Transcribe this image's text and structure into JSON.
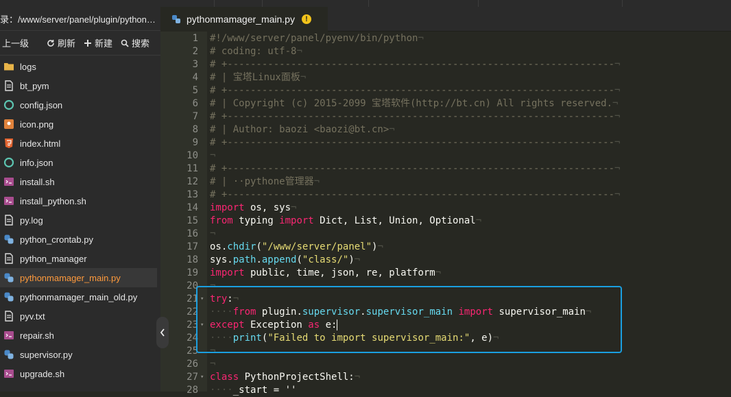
{
  "sidebar": {
    "path": "录：/www/server/panel/plugin/pythonm...",
    "toolbar": {
      "up": "上一级",
      "refresh": "刷新",
      "new": "新建",
      "search": "搜索"
    },
    "files": [
      {
        "name": "logs",
        "type": "folder-icon"
      },
      {
        "name": "bt_pym",
        "type": "file-icon"
      },
      {
        "name": "config.json",
        "type": "json-icon"
      },
      {
        "name": "icon.png",
        "type": "image-icon"
      },
      {
        "name": "index.html",
        "type": "html-icon"
      },
      {
        "name": "info.json",
        "type": "json-icon"
      },
      {
        "name": "install.sh",
        "type": "shell-icon"
      },
      {
        "name": "install_python.sh",
        "type": "shell-icon"
      },
      {
        "name": "py.log",
        "type": "file-icon"
      },
      {
        "name": "python_crontab.py",
        "type": "python-icon"
      },
      {
        "name": "python_manager",
        "type": "file-icon"
      },
      {
        "name": "pythonmamager_main.py",
        "type": "python-icon",
        "active": true
      },
      {
        "name": "pythonmamager_main_old.py",
        "type": "python-icon"
      },
      {
        "name": "pyv.txt",
        "type": "file-icon"
      },
      {
        "name": "repair.sh",
        "type": "shell-icon"
      },
      {
        "name": "supervisor.py",
        "type": "python-icon"
      },
      {
        "name": "upgrade.sh",
        "type": "shell-icon"
      }
    ]
  },
  "tab": {
    "title": "pythonmamager_main.py",
    "warning": "!"
  },
  "editor": {
    "lines": [
      {
        "n": "1",
        "tokens": [
          [
            "c",
            "#!/www/server/panel/pyenv/bin/python"
          ],
          [
            "w",
            "¬"
          ]
        ]
      },
      {
        "n": "2",
        "tokens": [
          [
            "c",
            "# coding: utf-8"
          ],
          [
            "w",
            "¬"
          ]
        ]
      },
      {
        "n": "3",
        "tokens": [
          [
            "c",
            "# +-------------------------------------------------------------------"
          ],
          [
            "w",
            "¬"
          ]
        ]
      },
      {
        "n": "4",
        "tokens": [
          [
            "c",
            "# | 宝塔Linux面板"
          ],
          [
            "w",
            "¬"
          ]
        ]
      },
      {
        "n": "5",
        "tokens": [
          [
            "c",
            "# +-------------------------------------------------------------------"
          ],
          [
            "w",
            "¬"
          ]
        ]
      },
      {
        "n": "6",
        "tokens": [
          [
            "c",
            "# | Copyright (c) 2015-2099 宝塔软件(http://bt.cn) All rights reserved."
          ],
          [
            "w",
            "¬"
          ]
        ]
      },
      {
        "n": "7",
        "tokens": [
          [
            "c",
            "# +-------------------------------------------------------------------"
          ],
          [
            "w",
            "¬"
          ]
        ]
      },
      {
        "n": "8",
        "tokens": [
          [
            "c",
            "# | Author: baozi <baozi@bt.cn>"
          ],
          [
            "w",
            "¬"
          ]
        ]
      },
      {
        "n": "9",
        "tokens": [
          [
            "c",
            "# +-------------------------------------------------------------------"
          ],
          [
            "w",
            "¬"
          ]
        ]
      },
      {
        "n": "10",
        "tokens": [
          [
            "w",
            "¬"
          ]
        ]
      },
      {
        "n": "11",
        "tokens": [
          [
            "c",
            "# +-------------------------------------------------------------------"
          ],
          [
            "w",
            "¬"
          ]
        ]
      },
      {
        "n": "12",
        "tokens": [
          [
            "c",
            "# | ··pythone管理器"
          ],
          [
            "w",
            "¬"
          ]
        ]
      },
      {
        "n": "13",
        "tokens": [
          [
            "c",
            "# +-------------------------------------------------------------------"
          ],
          [
            "w",
            "¬"
          ]
        ]
      },
      {
        "n": "14",
        "tokens": [
          [
            "k",
            "import"
          ],
          [
            "p",
            " os, sys"
          ],
          [
            "w",
            "¬"
          ]
        ]
      },
      {
        "n": "15",
        "tokens": [
          [
            "k",
            "from"
          ],
          [
            "p",
            " typing "
          ],
          [
            "k",
            "import"
          ],
          [
            "p",
            " Dict, List, Union, Optional"
          ],
          [
            "w",
            "¬"
          ]
        ]
      },
      {
        "n": "16",
        "tokens": [
          [
            "w",
            "¬"
          ]
        ]
      },
      {
        "n": "17",
        "tokens": [
          [
            "p",
            "os."
          ],
          [
            "f",
            "chdir"
          ],
          [
            "p",
            "("
          ],
          [
            "s",
            "\"/www/server/panel\""
          ],
          [
            "p",
            ")"
          ],
          [
            "w",
            "¬"
          ]
        ]
      },
      {
        "n": "18",
        "tokens": [
          [
            "p",
            "sys."
          ],
          [
            "f",
            "path"
          ],
          [
            "p",
            "."
          ],
          [
            "f",
            "append"
          ],
          [
            "p",
            "("
          ],
          [
            "s",
            "\"class/\""
          ],
          [
            "p",
            ")"
          ],
          [
            "w",
            "¬"
          ]
        ]
      },
      {
        "n": "19",
        "tokens": [
          [
            "k",
            "import"
          ],
          [
            "p",
            " public, time, json, re, platform"
          ],
          [
            "w",
            "¬"
          ]
        ]
      },
      {
        "n": "20",
        "tokens": [
          [
            "w",
            "¬"
          ]
        ]
      },
      {
        "n": "21",
        "fold": true,
        "tokens": [
          [
            "k",
            "try"
          ],
          [
            "p",
            ":"
          ],
          [
            "w",
            "¬"
          ]
        ]
      },
      {
        "n": "22",
        "tokens": [
          [
            "w",
            "····"
          ],
          [
            "k",
            "from"
          ],
          [
            "p",
            " plugin."
          ],
          [
            "f",
            "supervisor"
          ],
          [
            "p",
            "."
          ],
          [
            "f",
            "supervisor_main"
          ],
          [
            "p",
            " "
          ],
          [
            "k",
            "import"
          ],
          [
            "p",
            " supervisor_main"
          ],
          [
            "w",
            "¬"
          ]
        ]
      },
      {
        "n": "23",
        "fold": true,
        "tokens": [
          [
            "k",
            "except"
          ],
          [
            "p",
            " Exception "
          ],
          [
            "k",
            "as"
          ],
          [
            "p",
            " e:"
          ],
          [
            "cursor",
            ""
          ]
        ]
      },
      {
        "n": "24",
        "tokens": [
          [
            "w",
            "····"
          ],
          [
            "f",
            "print"
          ],
          [
            "p",
            "("
          ],
          [
            "s",
            "\"Failed to import supervisor_main:\""
          ],
          [
            "p",
            ", e)"
          ],
          [
            "w",
            "¬"
          ]
        ]
      },
      {
        "n": "25",
        "tokens": [
          [
            "w",
            "¬"
          ]
        ]
      },
      {
        "n": "26",
        "tokens": [
          [
            "w",
            "¬"
          ]
        ]
      },
      {
        "n": "27",
        "fold": true,
        "tokens": [
          [
            "k",
            "class"
          ],
          [
            "p",
            " PythonProjectShell:"
          ],
          [
            "w",
            "¬"
          ]
        ]
      },
      {
        "n": "28",
        "tokens": [
          [
            "w",
            "····"
          ],
          [
            "p",
            "_start = ''"
          ]
        ]
      }
    ]
  },
  "colors": {
    "accent": "#ff9a3c",
    "highlight_border": "#1a9fe0",
    "editor_bg": "#272822"
  }
}
